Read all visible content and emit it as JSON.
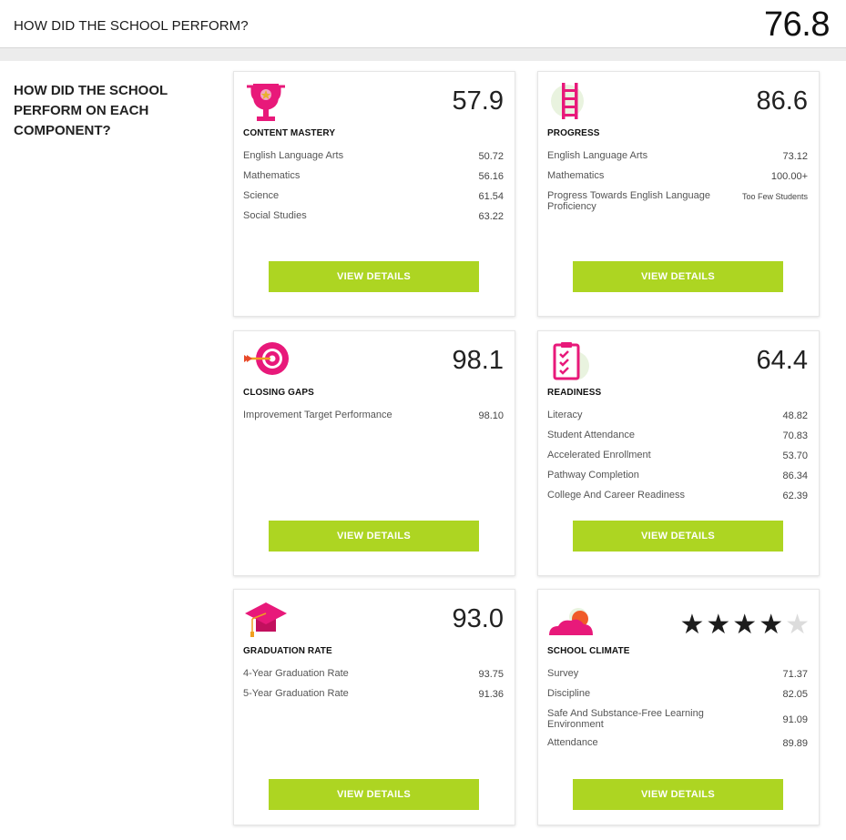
{
  "header": {
    "title": "HOW DID THE SCHOOL PERFORM?",
    "score": "76.8"
  },
  "question": "HOW DID THE SCHOOL PERFORM ON EACH COMPONENT?",
  "button_label": "VIEW DETAILS",
  "colors": {
    "accent_green": "#add522",
    "icon_pink": "#e8197a"
  },
  "cards": [
    {
      "icon": "trophy-icon",
      "score": "57.9",
      "title": "CONTENT MASTERY",
      "rows": [
        {
          "label": "English Language Arts",
          "value": "50.72"
        },
        {
          "label": "Mathematics",
          "value": "56.16"
        },
        {
          "label": "Science",
          "value": "61.54"
        },
        {
          "label": "Social Studies",
          "value": "63.22"
        }
      ]
    },
    {
      "icon": "ladder-icon",
      "score": "86.6",
      "title": "PROGRESS",
      "rows": [
        {
          "label": "English Language Arts",
          "value": "73.12"
        },
        {
          "label": "Mathematics",
          "value": "100.00+"
        },
        {
          "label": "Progress Towards English Language Proficiency",
          "value": "Too Few Students"
        }
      ]
    },
    {
      "icon": "target-icon",
      "score": "98.1",
      "title": "CLOSING GAPS",
      "rows": [
        {
          "label": "Improvement Target Performance",
          "value": "98.10"
        }
      ]
    },
    {
      "icon": "checklist-icon",
      "score": "64.4",
      "title": "READINESS",
      "rows": [
        {
          "label": "Literacy",
          "value": "48.82"
        },
        {
          "label": "Student Attendance",
          "value": "70.83"
        },
        {
          "label": "Accelerated Enrollment",
          "value": "53.70"
        },
        {
          "label": "Pathway Completion",
          "value": "86.34"
        },
        {
          "label": "College And Career Readiness",
          "value": "62.39"
        }
      ]
    },
    {
      "icon": "graduation-cap-icon",
      "score": "93.0",
      "title": "GRADUATION RATE",
      "rows": [
        {
          "label": "4-Year Graduation Rate",
          "value": "93.75"
        },
        {
          "label": "5-Year Graduation Rate",
          "value": "91.36"
        }
      ]
    },
    {
      "icon": "sunset-cloud-icon",
      "rating": {
        "filled": 4,
        "total": 5
      },
      "title": "SCHOOL CLIMATE",
      "rows": [
        {
          "label": "Survey",
          "value": "71.37"
        },
        {
          "label": "Discipline",
          "value": "82.05"
        },
        {
          "label": "Safe And Substance-Free Learning Environment",
          "value": "91.09"
        },
        {
          "label": "Attendance",
          "value": "89.89"
        }
      ]
    }
  ]
}
